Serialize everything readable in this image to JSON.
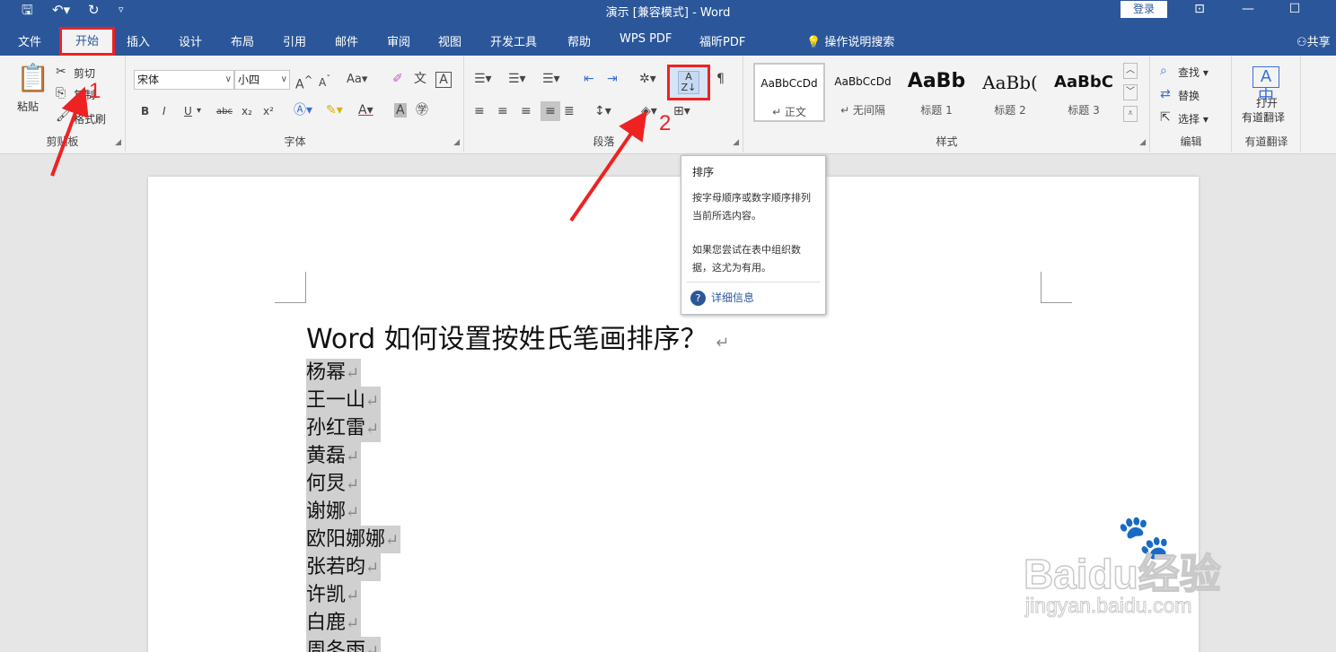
{
  "titlebar": {
    "title": "演示 [兼容模式]  -  Word",
    "login": "登录",
    "icons": [
      "save-icon",
      "undo-icon",
      "redo-icon",
      "customize-icon",
      "ribbon-options-icon",
      "minimize-icon",
      "restore-icon"
    ]
  },
  "tabs": [
    "文件",
    "开始",
    "插入",
    "设计",
    "布局",
    "引用",
    "邮件",
    "审阅",
    "视图",
    "开发工具",
    "帮助",
    "WPS PDF",
    "福昕PDF"
  ],
  "tellme": "操作说明搜索",
  "share": "共享",
  "clipboard": {
    "paste": "粘贴",
    "cut": "剪切",
    "copy": "复制",
    "format_painter": "格式刷",
    "label": "剪贴板"
  },
  "font": {
    "name": "宋体",
    "size": "小四",
    "change_case": "Aa",
    "label": "字体"
  },
  "paragraph": {
    "label": "段落"
  },
  "styles": {
    "items": [
      {
        "sample": "AaBbCcDd",
        "name": "↵ 正文"
      },
      {
        "sample": "AaBbCcDd",
        "name": "↵ 无间隔"
      },
      {
        "sample": "AaBb",
        "name": "标题 1"
      },
      {
        "sample": "AaBb(",
        "name": "标题 2"
      },
      {
        "sample": "AaBbC",
        "name": "标题 3"
      }
    ],
    "label": "样式"
  },
  "editing": {
    "find": "查找",
    "replace": "替换",
    "select": "选择",
    "label": "编辑"
  },
  "youdao": {
    "open": "打开",
    "translate": "有道翻译",
    "label": "有道翻译"
  },
  "tooltip": {
    "title": "排序",
    "body1": "按字母顺序或数字顺序排列当前所选内容。",
    "body2": "如果您尝试在表中组织数据，这尤为有用。",
    "link": "详细信息"
  },
  "document": {
    "title": "Word 如何设置按姓氏笔画排序？",
    "names": [
      "杨幂",
      "王一山",
      "孙红雷",
      "黄磊",
      "何炅",
      "谢娜",
      "欧阳娜娜",
      "张若昀",
      "许凯",
      "白鹿",
      "周冬雨"
    ],
    "para_mark": "↵"
  },
  "annotations": {
    "one": "1",
    "two": "2"
  },
  "watermark": {
    "main": "Baidu经验",
    "sub": "jingyan.baidu.com"
  },
  "colors": {
    "brand": "#2b579a",
    "highlight": "#e22222",
    "selection": "#d0d0d0"
  }
}
